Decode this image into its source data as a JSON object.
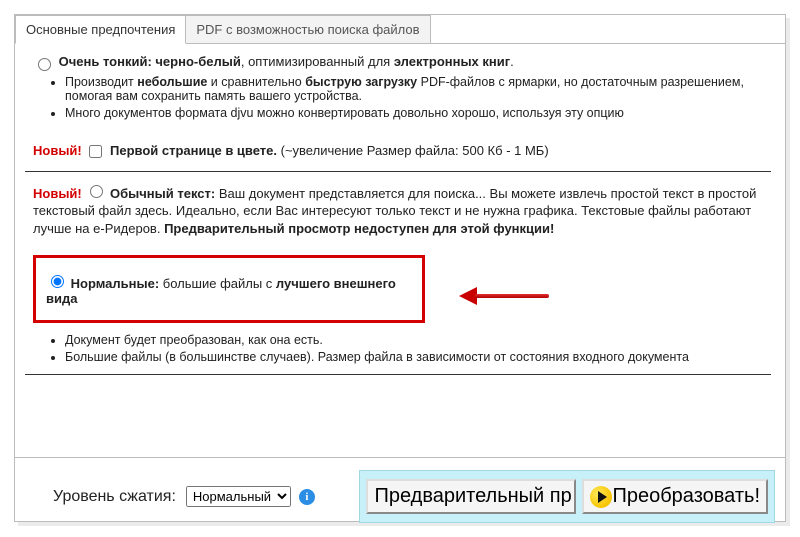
{
  "tabs": {
    "basic": "Основные предпочтения",
    "pdf": "PDF с возможностью поиска файлов"
  },
  "opt_thin": {
    "label_b1": "Очень тонкий: черно-белый",
    "label_plain1": ", оптимизированный для ",
    "label_b2": "электронных книг",
    "tail": ".",
    "bullet1a": "Производит ",
    "bullet1b": "небольшие",
    "bullet1c": " и сравнительно ",
    "bullet1d": "быструю загрузку",
    "bullet1e": " PDF-файлов с ярмарки, но достаточным разрешением, помогая вам сохранить память вашего устройства.",
    "bullet2": "Много документов формата djvu можно конвертировать довольно хорошо, используя эту опцию"
  },
  "new_label": "Новый!",
  "color_first": {
    "label_b": "Первой странице в цвете.",
    "note": " (~увеличение Размер файла: 500 Кб - 1 МБ)"
  },
  "plain_text": {
    "b1": "Обычный текст:",
    "t1": " Ваш документ представляется для поиска... Вы можете извлечь простой текст в простой текстовый файл здесь. Идеально, если Вас интересуют только текст и не нужна графика. Текстовые файлы работают лучше на e-Ридеров. ",
    "b2": "Предварительный просмотр недоступен для этой функции!"
  },
  "normal": {
    "b1": "Нормальные:",
    "t1": " большие файлы с ",
    "b2": "лучшего внешнего вида",
    "bullet1": "Документ будет преобразован, как она есть.",
    "bullet2": "Большие файлы (в большинстве случаев). Размер файла в зависимости от состояния входного документа"
  },
  "bottom": {
    "compression_label": "Уровень сжатия:",
    "compression_value": "Нормальный",
    "preview_btn": "Предварительный пр",
    "convert_btn": "Преобразовать!"
  }
}
